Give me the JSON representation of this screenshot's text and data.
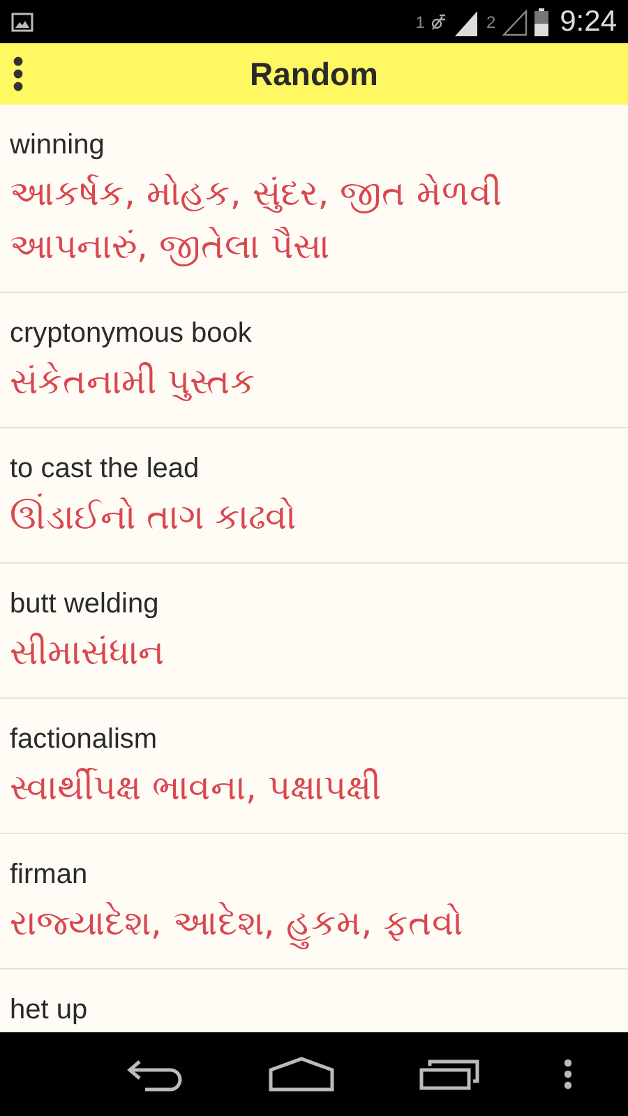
{
  "status_bar": {
    "sim_1": "1",
    "sim_2": "2",
    "time": "9:24"
  },
  "header": {
    "title": "Random"
  },
  "entries": [
    {
      "word": "winning",
      "meaning": "આકર્ષક, મોહક, સુંદર, જીત મેળવી આપનારું, જીતેલા પૈસા"
    },
    {
      "word": "cryptonymous book",
      "meaning": "સંકેતનામી પુસ્તક"
    },
    {
      "word": "to cast the lead",
      "meaning": "ઊંડાઈનો તાગ કાઢવો"
    },
    {
      "word": "butt welding",
      "meaning": "સીમાસંધાન"
    },
    {
      "word": "factionalism",
      "meaning": "સ્વાર્થીપક્ષ ભાવના, પક્ષાપક્ષી"
    },
    {
      "word": "firman",
      "meaning": "રાજ્યાદેશ, આદેશ, હુકમ, ફતવો"
    },
    {
      "word": "het up"
    }
  ]
}
